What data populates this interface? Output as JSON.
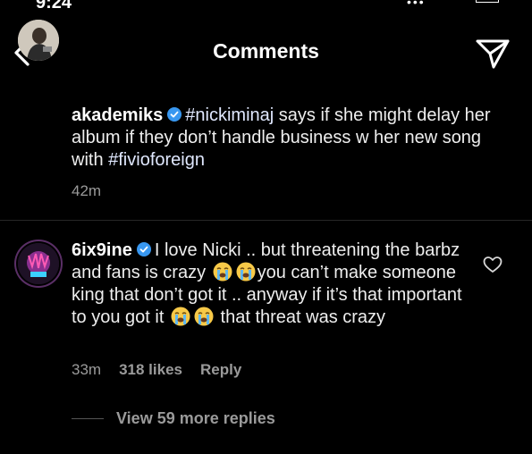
{
  "status_bar": {
    "time": "9:24"
  },
  "header": {
    "title": "Comments"
  },
  "caption": {
    "username": "akademiks",
    "verified": true,
    "text_pre": "",
    "mention1": "#nickiminaj",
    "text_mid": " says if she might delay her album if they don’t handle business w her new song with ",
    "mention2": "#fivioforeign",
    "time": "42m"
  },
  "comment": {
    "username": "6ix9ine",
    "verified": true,
    "text_a": "I love Nicki .. but threatening the barbz and fans is crazy ",
    "text_b": "you can’t make someone king that don’t got it .. anyway if it’s that important to you got it ",
    "text_c": " that threat was crazy",
    "time": "33m",
    "likes": "318 likes",
    "reply_label": "Reply"
  },
  "replies": {
    "label": "View 59 more replies"
  },
  "icons": {
    "back": "chevron-left-icon",
    "send": "paper-plane-icon",
    "heart": "heart-outline-icon",
    "verified": "verified-badge-icon",
    "emoji": "loudly-crying-face-emoji"
  },
  "colors": {
    "background": "#000000",
    "verified": "#3897f0",
    "muted": "#9a9a9a"
  }
}
